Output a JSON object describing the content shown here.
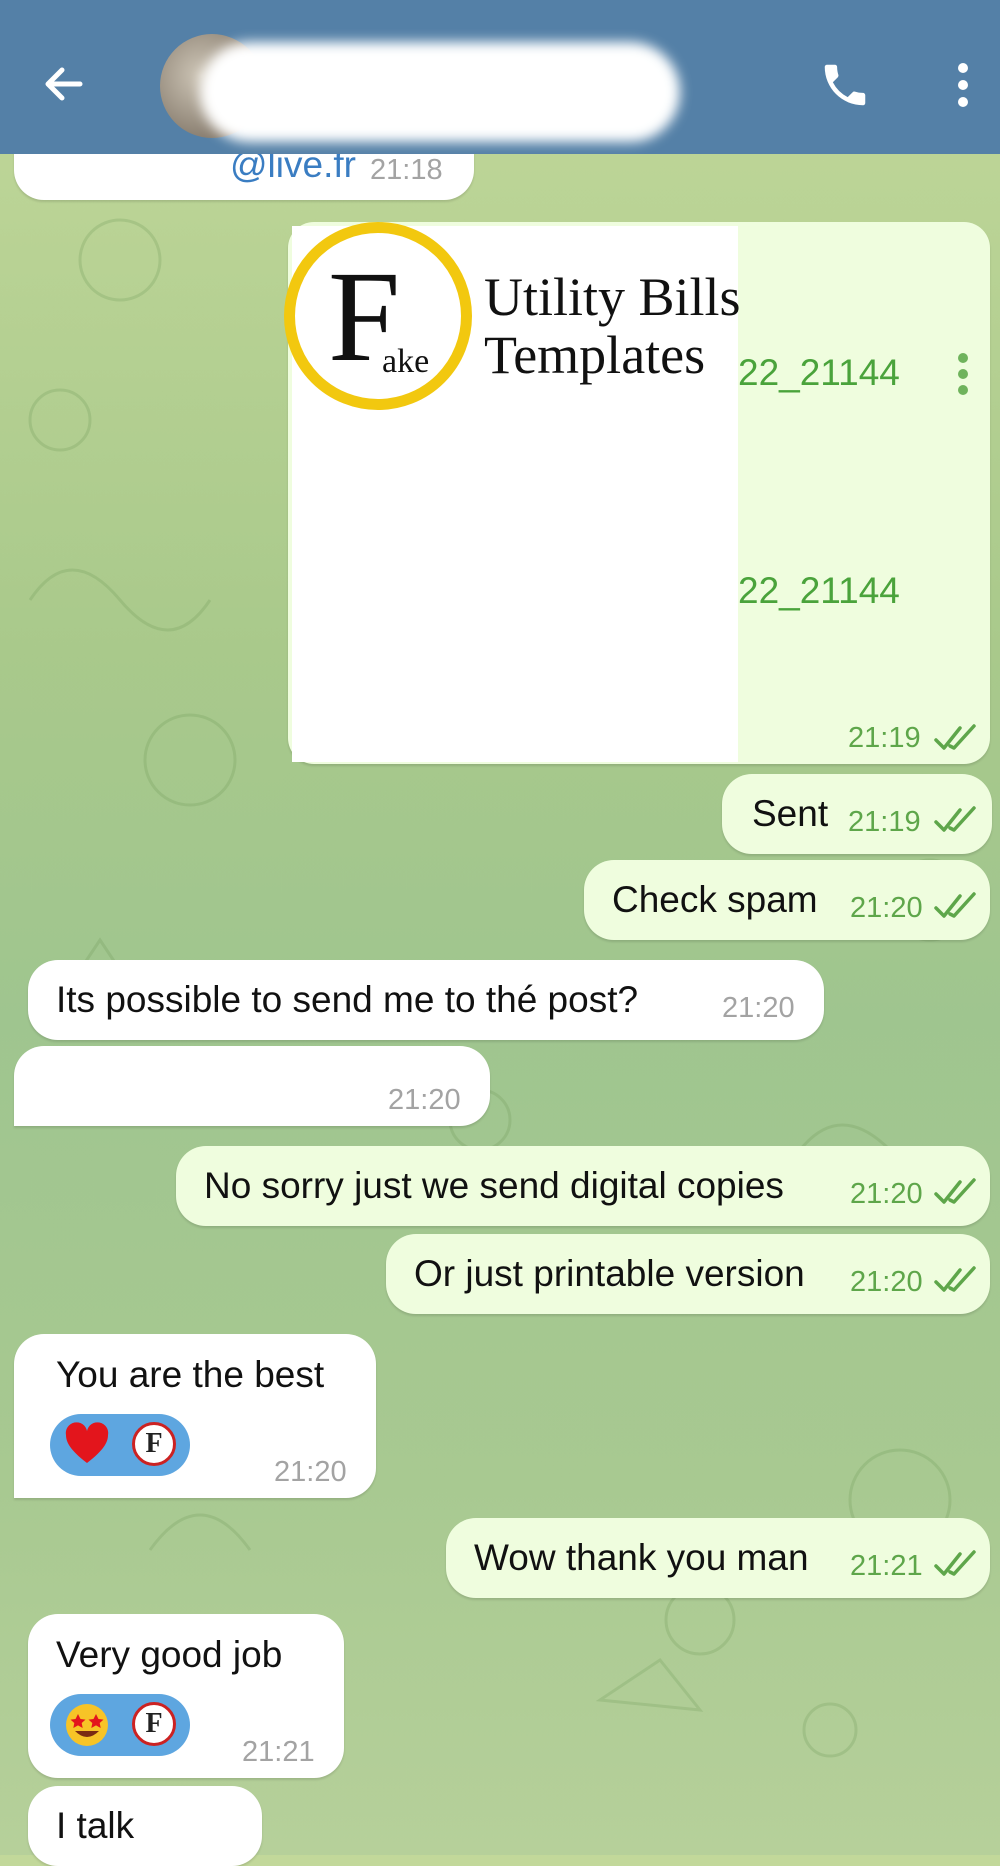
{
  "header": {
    "back_icon": "arrow-left-icon",
    "call_icon": "phone-icon",
    "menu_icon": "more-vertical-icon",
    "bar_color": "#5480a7"
  },
  "messages": {
    "m0": {
      "text": "@live.fr",
      "time": "21:18"
    },
    "doc": {
      "logo_letter": "F",
      "logo_sub": "ake",
      "logo_title_1": "Utility Bills",
      "logo_title_2": "Templates",
      "file1": "22_21144",
      "file2": "22_21144",
      "time": "21:19"
    },
    "m1": {
      "text": "Sent",
      "time": "21:19"
    },
    "m2": {
      "text": "Check spam",
      "time": "21:20"
    },
    "m3": {
      "text": "Its  possible  to send me to thé post?",
      "time": "21:20"
    },
    "m4": {
      "text": "",
      "time": "21:20"
    },
    "m5": {
      "text": "No sorry just we send digital copies",
      "time": "21:20"
    },
    "m6": {
      "text": "Or just printable version",
      "time": "21:20"
    },
    "m7": {
      "text": "You  are the best",
      "time": "21:20",
      "reaction_badge": "F"
    },
    "m8": {
      "text": "Wow thank you man",
      "time": "21:21"
    },
    "m9": {
      "text": "Very  good  job",
      "time": "21:21",
      "reaction_badge": "F"
    },
    "m10": {
      "text": "I talk"
    }
  },
  "colors": {
    "outgoing_bubble": "#effdde",
    "incoming_bubble": "#ffffff",
    "outgoing_time": "#5ea64a",
    "reaction_pill": "#5ea6e0"
  }
}
